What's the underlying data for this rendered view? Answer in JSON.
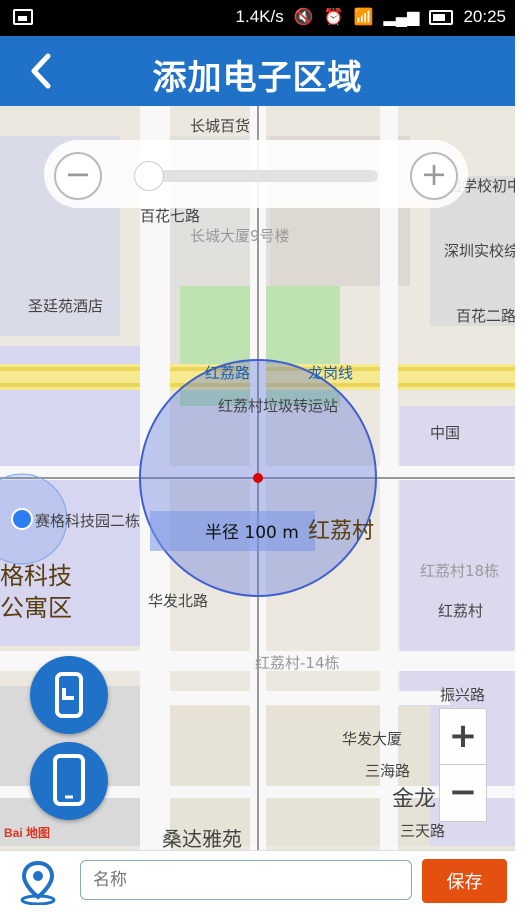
{
  "status_bar": {
    "speed": "1.4K/s",
    "time": "20:25"
  },
  "header": {
    "title": "添加电子区域"
  },
  "map": {
    "zoom_minus": "−",
    "zoom_plus": "+",
    "radius_label": "半径 100 m",
    "labels": [
      "长城百货",
      "长城大厦9号楼",
      "百花七路",
      "圣廷苑酒店",
      "红荔路",
      "龙岗线",
      "红荔村垃圾转运站",
      "中国",
      "赛格科技园二栋",
      "红荔村",
      "红荔村18栋",
      "华发北路",
      "红荔村-14栋",
      "振兴路",
      "华发大厦",
      "三海路",
      "金龙",
      "三天路",
      "桑达雅苑",
      "实验学校初中部",
      "深圳实校综合",
      "百花二路",
      "红荔村"
    ],
    "left_labels": [
      "格科技",
      "公寓区"
    ],
    "zoom_in": "+",
    "zoom_out": "−",
    "logo": "Bai 地图"
  },
  "form": {
    "name_placeholder": "名称",
    "save_label": "保存"
  }
}
